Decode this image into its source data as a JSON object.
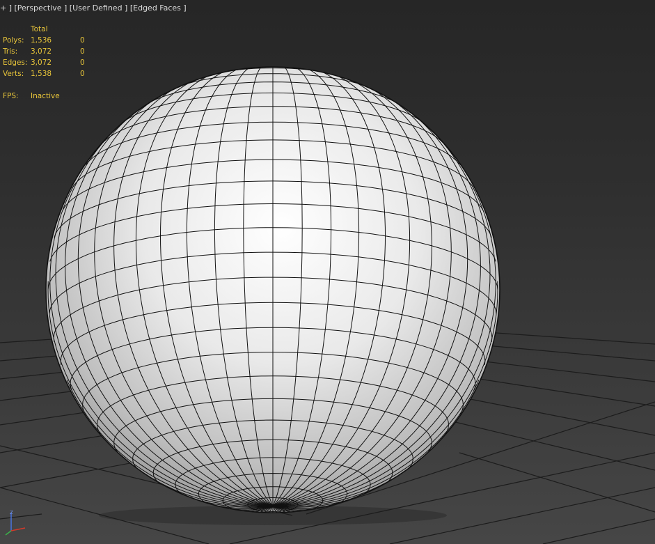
{
  "viewport": {
    "menu_plus": "+",
    "view": "Perspective",
    "shading": "User Defined",
    "display": "Edged Faces"
  },
  "stats": {
    "header": "Total",
    "rows": [
      {
        "label": "Polys:",
        "total": "1,536",
        "selected": "0"
      },
      {
        "label": "Tris:",
        "total": "3,072",
        "selected": "0"
      },
      {
        "label": "Edges:",
        "total": "3,072",
        "selected": "0"
      },
      {
        "label": "Verts:",
        "total": "1,538",
        "selected": "0"
      }
    ],
    "fps_label": "FPS:",
    "fps_value": "Inactive"
  },
  "axis_gizmo": {
    "z_label": "z"
  },
  "colors": {
    "stats_text": "#e8c53a",
    "grid_line": "#1c1c1c",
    "mesh_edge": "#111111",
    "axis_x": "#d23a2a",
    "axis_y": "#3bb34a",
    "axis_z": "#4a74e0"
  }
}
